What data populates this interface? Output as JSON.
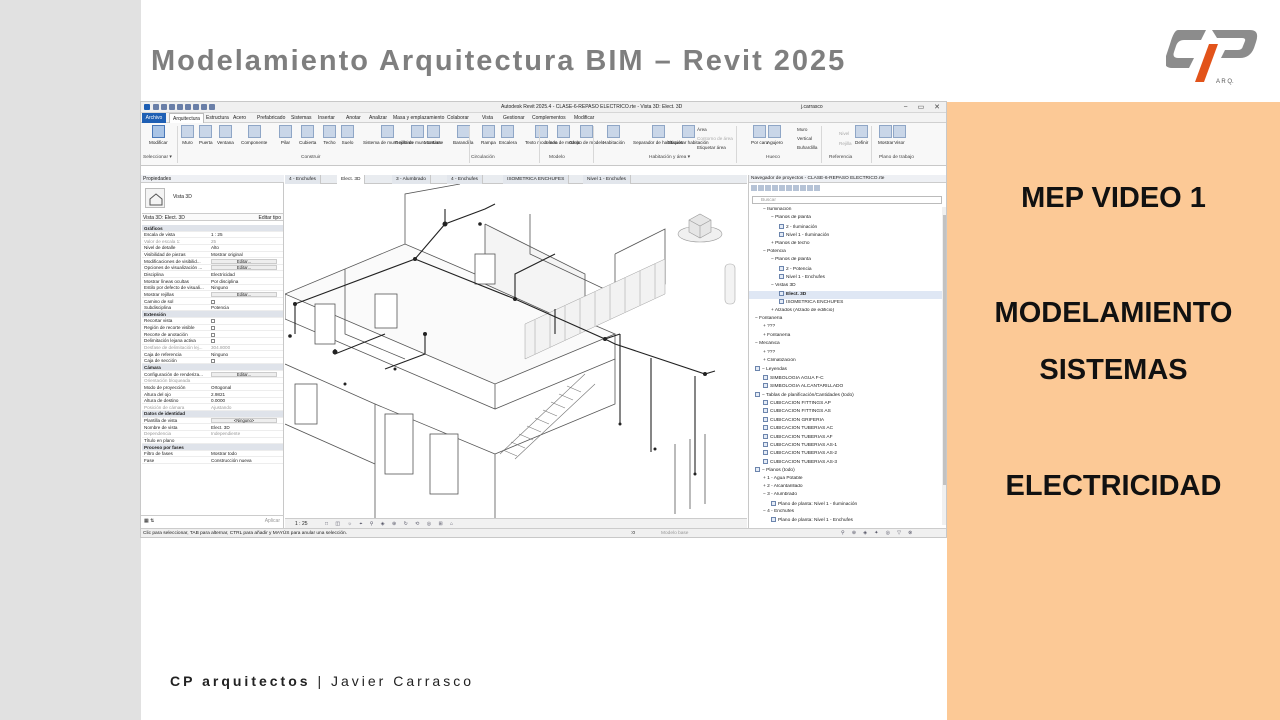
{
  "slide": {
    "title": "Modelamiento Arquitectura BIM – Revit 2025",
    "logo_letters": "CP",
    "logo_sub": "A R Q.",
    "right_lines": [
      "MEP VIDEO 1",
      "MODELAMIENTO",
      "SISTEMAS",
      "ELECTRICIDAD"
    ],
    "footer_brand": "CP arquitectos",
    "footer_sep": "|",
    "footer_name": "Javier Carrasco",
    "colors": {
      "accent": "#fcc996",
      "title": "#7f7f7f",
      "logo_gray": "#8c8c8c",
      "logo_red": "#e2531a"
    }
  },
  "revit": {
    "window_title": "Autodesk Revit 2025.4 - CLASE-6-REPASO ELECTRICO.rte - Vista 3D: Elect. 3D",
    "user": "j.carrasco",
    "menu": [
      "Archivo",
      "Arquitectura",
      "Estructura",
      "Acero",
      "Prefabricado",
      "Sistemas",
      "Insertar",
      "Anotar",
      "Analizar",
      "Masa y emplazamiento",
      "Colaborar",
      "Vista",
      "Gestionar",
      "Complementos",
      "Modificar"
    ],
    "ribbon_tools": [
      "Modificar",
      "Muro",
      "Puerta",
      "Ventana",
      "Componente",
      "Pilar",
      "Cubierta",
      "Techo",
      "Suelo",
      "Sistema de muro cortina",
      "Rejilla de muro cortina",
      "Montante",
      "Barandilla",
      "Rampa",
      "Escalera",
      "Texto modelado",
      "Línea de modelo",
      "Grupo de modelo",
      "Habitación",
      "Separador de habitación",
      "Etiquetar habitación",
      "Por cara",
      "Agujero",
      "Definir",
      "Mostrar",
      "Visor"
    ],
    "ribbon_small": [
      "Área",
      "Contorno de área",
      "Etiquetar área",
      "Muro",
      "Vertical",
      "Buhardilla",
      "Nivel",
      "Rejilla",
      "Plano de ref."
    ],
    "ribbon_groups": [
      "Seleccionar ▾",
      "Construir",
      "Circulación",
      "Modelo",
      "Habitación y área ▾",
      "Hueco",
      "Referencia",
      "Plano de trabajo"
    ],
    "properties": {
      "header": "Propiedades",
      "type_label": "Vista 3D",
      "selector": "Vista 3D: Elect. 3D",
      "edit_type": "Editar tipo",
      "apply": "Aplicar",
      "rows": [
        {
          "k": "Gráficos",
          "v": "",
          "kind": "sec"
        },
        {
          "k": "Escala de vista",
          "v": "1 : 25"
        },
        {
          "k": "Valor de escala   1:",
          "v": "25",
          "kind": "dim"
        },
        {
          "k": "Nivel de detalle",
          "v": "Alto"
        },
        {
          "k": "Visibilidad de piezas",
          "v": "Mostrar original"
        },
        {
          "k": "Modificaciones de visibilid...",
          "v": "Editar...",
          "kind": "btn"
        },
        {
          "k": "Opciones de visualización ...",
          "v": "Editar...",
          "kind": "btn"
        },
        {
          "k": "Disciplina",
          "v": "Electricidad"
        },
        {
          "k": "Mostrar líneas ocultas",
          "v": "Por disciplina"
        },
        {
          "k": "Estilo por defecto de visuali...",
          "v": "Ninguno"
        },
        {
          "k": "Mostrar rejillas",
          "v": "Editar...",
          "kind": "btn"
        },
        {
          "k": "Camino de sol",
          "v": "",
          "kind": "cb"
        },
        {
          "k": "Subdisciplina",
          "v": "Potencia"
        },
        {
          "k": "Extensión",
          "v": "",
          "kind": "sec"
        },
        {
          "k": "Recortar vista",
          "v": "",
          "kind": "cb"
        },
        {
          "k": "Región de recorte visible",
          "v": "",
          "kind": "cb"
        },
        {
          "k": "Recorte de anotación",
          "v": "",
          "kind": "cb"
        },
        {
          "k": "Delimitación lejana activa",
          "v": "",
          "kind": "cb"
        },
        {
          "k": "Desfase de delimitación lej...",
          "v": "304.8000",
          "kind": "dim"
        },
        {
          "k": "Caja de referencia",
          "v": "Ninguno"
        },
        {
          "k": "Caja de sección",
          "v": "",
          "kind": "cb"
        },
        {
          "k": "Cámara",
          "v": "",
          "kind": "sec"
        },
        {
          "k": "Configuración de renderiza...",
          "v": "Editar...",
          "kind": "btn"
        },
        {
          "k": "Orientación bloqueada",
          "v": "",
          "kind": "dim"
        },
        {
          "k": "Modo de proyección",
          "v": "Ortogonal"
        },
        {
          "k": "Altura del ojo",
          "v": "2.9821"
        },
        {
          "k": "Altura de destino",
          "v": "0.0000"
        },
        {
          "k": "Posición de cámara",
          "v": "Ajustando",
          "kind": "dim"
        },
        {
          "k": "Datos de identidad",
          "v": "",
          "kind": "sec"
        },
        {
          "k": "Plantilla de vista",
          "v": "<Ninguno>",
          "kind": "btn"
        },
        {
          "k": "Nombre de vista",
          "v": "Elect. 3D"
        },
        {
          "k": "Dependencia",
          "v": "Independiente",
          "kind": "dim"
        },
        {
          "k": "Título en plano",
          "v": ""
        },
        {
          "k": "Proceso por fases",
          "v": "",
          "kind": "sec"
        },
        {
          "k": "Filtro de fases",
          "v": "Mostrar todo"
        },
        {
          "k": "Fase",
          "v": "Construcción nueva"
        }
      ]
    },
    "view_tabs": [
      "4 - Enchufes",
      "Elect. 3D",
      "3 - Alumbrado",
      "4 - Enchufes",
      "ISOMETRICA ENCHUFES",
      "Nivel 1 - Enchufes"
    ],
    "view_scale": "1 : 25",
    "browser": {
      "header": "Navegador de proyectos - CLASE-6-REPASO ELECTRICO.rte",
      "search": "Buscar",
      "nodes": [
        {
          "t": "− Iluminación",
          "d": 1
        },
        {
          "t": "− Planos de planta",
          "d": 2
        },
        {
          "t": "2 - Iluminación",
          "d": 3,
          "i": 1
        },
        {
          "t": "Nivel 1 - Iluminación",
          "d": 3,
          "i": 1
        },
        {
          "t": "+ Planos de techo",
          "d": 2
        },
        {
          "t": "− Potencia",
          "d": 1
        },
        {
          "t": "− Planos de planta",
          "d": 2
        },
        {
          "t": "2 - Potencia",
          "d": 3,
          "i": 1
        },
        {
          "t": "Nivel 1 - Enchufes",
          "d": 3,
          "i": 1
        },
        {
          "t": "− Vistas 3D",
          "d": 2
        },
        {
          "t": "Elect. 3D",
          "d": 3,
          "i": 1,
          "sel": 1
        },
        {
          "t": "ISOMETRICA ENCHUFES",
          "d": 3,
          "i": 1
        },
        {
          "t": "+ Alzados (Alzado de edificio)",
          "d": 2
        },
        {
          "t": "− Fontanería",
          "d": 0
        },
        {
          "t": "+ ???",
          "d": 1
        },
        {
          "t": "+ Fontanería",
          "d": 1
        },
        {
          "t": "− Mecánica",
          "d": 0
        },
        {
          "t": "+ ???",
          "d": 1
        },
        {
          "t": "+ Climatización",
          "d": 1
        },
        {
          "t": "− Leyendas",
          "d": 0,
          "i": 1
        },
        {
          "t": "SIMBOLOGIA AGUA F-C",
          "d": 1,
          "i": 1
        },
        {
          "t": "SIMBOLOGIA ALCANTARILLADO",
          "d": 1,
          "i": 1
        },
        {
          "t": "− Tablas de planificación/Cantidades (todo)",
          "d": 0,
          "i": 1
        },
        {
          "t": "CUBICACION FITTINGS AP",
          "d": 1,
          "i": 1
        },
        {
          "t": "CUBICACION FITTINGS AS",
          "d": 1,
          "i": 1
        },
        {
          "t": "CUBICACION GRIFERIA",
          "d": 1,
          "i": 1
        },
        {
          "t": "CUBICACION TUBERIAS AC",
          "d": 1,
          "i": 1
        },
        {
          "t": "CUBICACION TUBERIAS AF",
          "d": 1,
          "i": 1
        },
        {
          "t": "CUBICACION TUBERIAS AS-1",
          "d": 1,
          "i": 1
        },
        {
          "t": "CUBICACION TUBERIAS AS-2",
          "d": 1,
          "i": 1
        },
        {
          "t": "CUBICACION TUBERIAS AS-3",
          "d": 1,
          "i": 1
        },
        {
          "t": "− Planos (todo)",
          "d": 0,
          "i": 1
        },
        {
          "t": "+ 1 - Agua Potable",
          "d": 1
        },
        {
          "t": "+ 2 - Alcantarillado",
          "d": 1
        },
        {
          "t": "− 3 - Alumbrado",
          "d": 1
        },
        {
          "t": "Plano de planta: Nivel 1 - Iluminación",
          "d": 2,
          "i": 1
        },
        {
          "t": "− 4 - Enchufes",
          "d": 1
        },
        {
          "t": "Plano de planta: Nivel 1 - Enchufes",
          "d": 2,
          "i": 1
        }
      ]
    },
    "status_text": "Clic para seleccionar, TAB para alternar, CTRL para añadir y MAYÚS para anular una selección.",
    "status_model": "Modelo base",
    "status_zero": ":0"
  }
}
